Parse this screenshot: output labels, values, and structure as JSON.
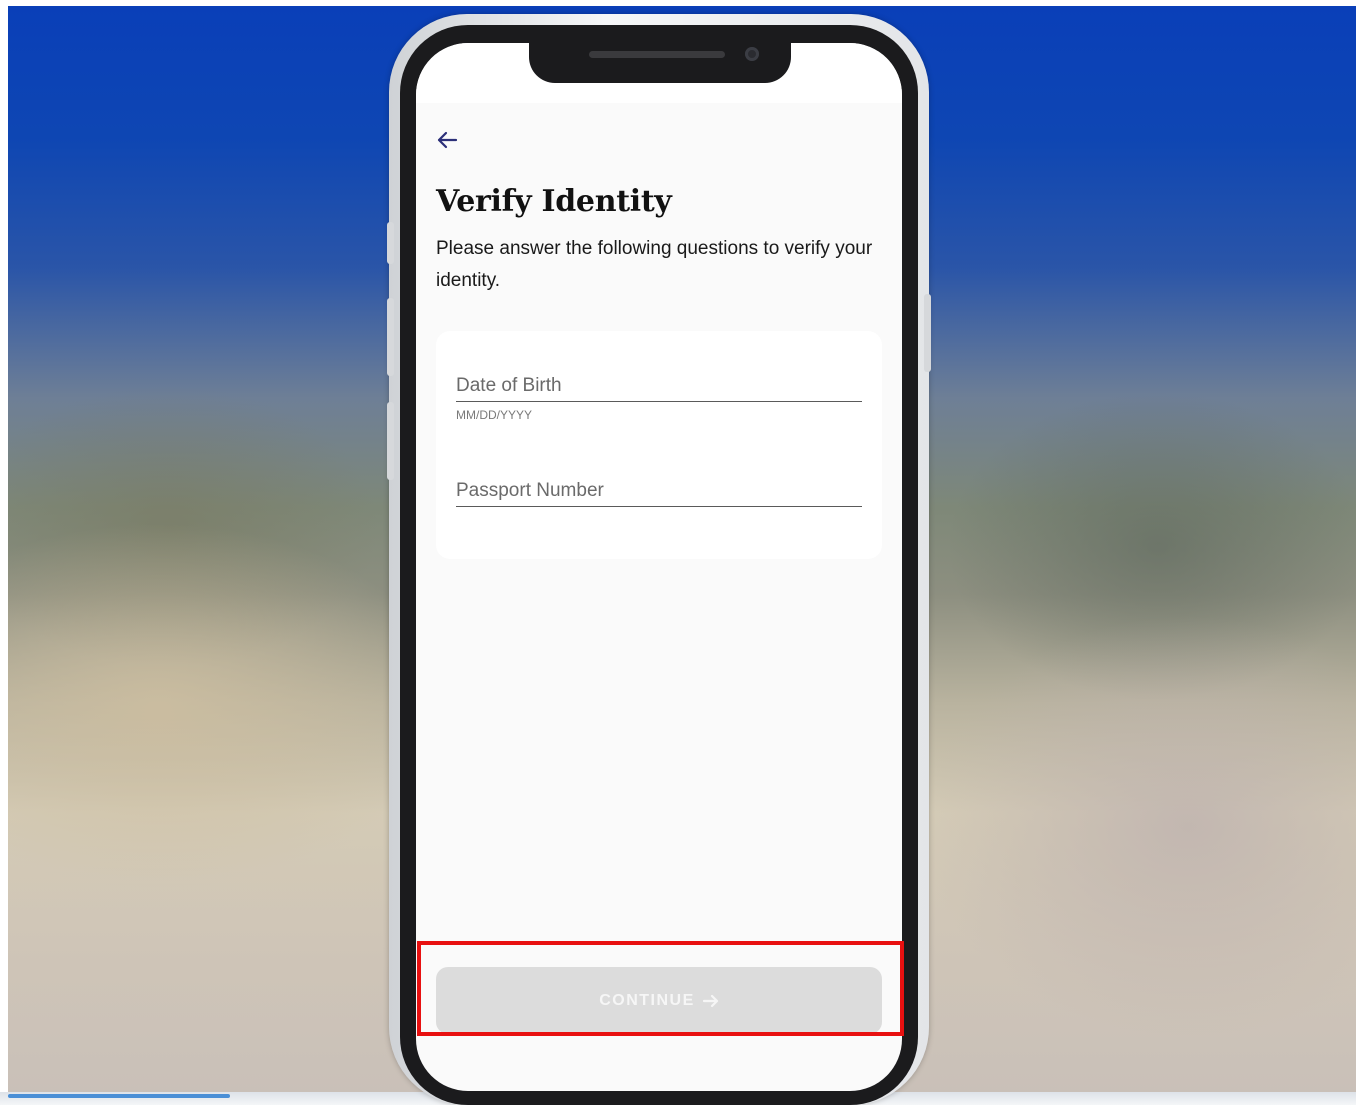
{
  "screen": {
    "title": "Verify Identity",
    "subtitle": "Please answer the following questions to verify your identity."
  },
  "form": {
    "dob": {
      "placeholder": "Date of Birth",
      "value": "",
      "hint": "MM/DD/YYYY"
    },
    "passport": {
      "placeholder": "Passport Number",
      "value": ""
    }
  },
  "actions": {
    "continue_label": "CONTINUE",
    "continue_icon": "arrow-right-icon",
    "back_icon": "arrow-left-icon"
  },
  "colors": {
    "highlight": "#e81010",
    "back_arrow": "#2b2f78",
    "button_disabled_bg": "#dcdcdc",
    "button_disabled_text": "#f6f6f6"
  }
}
